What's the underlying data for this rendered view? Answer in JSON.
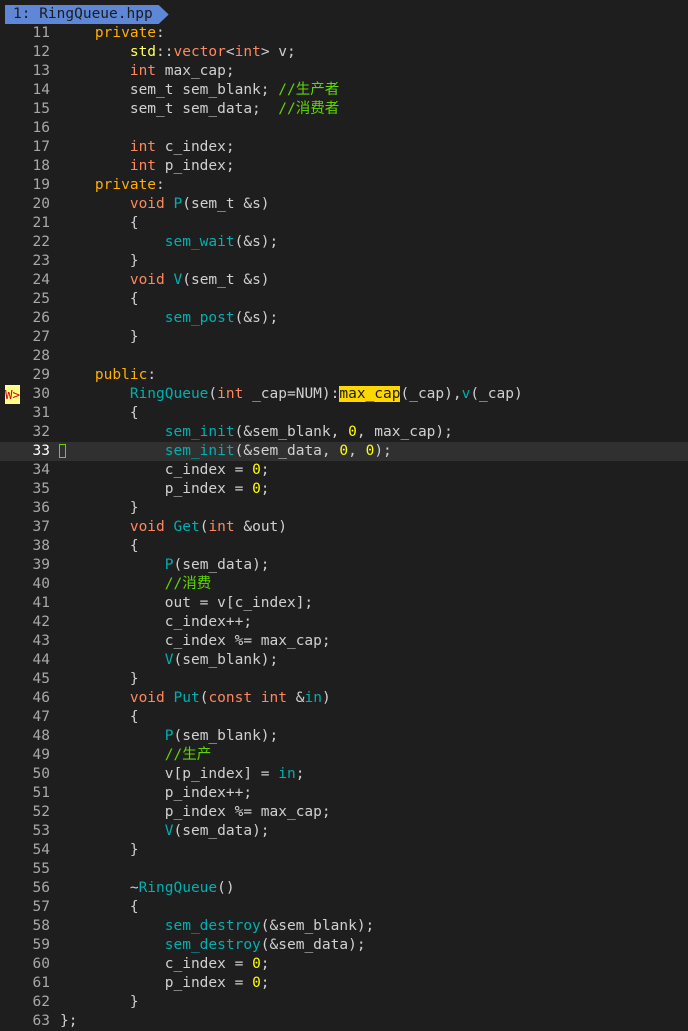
{
  "tab": {
    "label": "1: RingQueue.hpp"
  },
  "colors": {
    "background": "#1e1e1e",
    "tab": "#5f87d7",
    "keyword": "#ffaf00",
    "type": "#ff875f",
    "function": "#00afaf",
    "number": "#ffff00",
    "comment": "#5fd700",
    "sign": "#ffff87"
  },
  "editor": {
    "current_line": "33",
    "sign_label": "W>",
    "sign_line": "30",
    "lines": [
      {
        "n": "11",
        "t": [
          [
            "kw",
            "    private"
          ],
          [
            "",
            ":"
          ]
        ]
      },
      {
        "n": "12",
        "t": [
          [
            "ns",
            "        std"
          ],
          [
            "",
            "::"
          ],
          [
            "ty",
            "vector"
          ],
          [
            "",
            "<"
          ],
          [
            "ty",
            "int"
          ],
          [
            "",
            "> v;"
          ]
        ]
      },
      {
        "n": "13",
        "t": [
          [
            "ty",
            "        int"
          ],
          [
            "",
            " max_cap;"
          ]
        ]
      },
      {
        "n": "14",
        "t": [
          [
            "",
            "        sem_t sem_blank; "
          ],
          [
            "cm",
            "//生产者"
          ]
        ]
      },
      {
        "n": "15",
        "t": [
          [
            "",
            "        sem_t sem_data;  "
          ],
          [
            "cm",
            "//消费者"
          ]
        ]
      },
      {
        "n": "16",
        "t": []
      },
      {
        "n": "17",
        "t": [
          [
            "ty",
            "        int"
          ],
          [
            "",
            " c_index;"
          ]
        ]
      },
      {
        "n": "18",
        "t": [
          [
            "ty",
            "        int"
          ],
          [
            "",
            " p_index;"
          ]
        ]
      },
      {
        "n": "19",
        "t": [
          [
            "kw",
            "    private"
          ],
          [
            "",
            ":"
          ]
        ]
      },
      {
        "n": "20",
        "t": [
          [
            "ty",
            "        void"
          ],
          [
            "",
            " "
          ],
          [
            "fn",
            "P"
          ],
          [
            "",
            "(sem_t &s)"
          ]
        ]
      },
      {
        "n": "21",
        "t": [
          [
            "",
            "        {"
          ]
        ]
      },
      {
        "n": "22",
        "t": [
          [
            "fn",
            "            sem_wait"
          ],
          [
            "",
            "(&s);"
          ]
        ]
      },
      {
        "n": "23",
        "t": [
          [
            "",
            "        }"
          ]
        ]
      },
      {
        "n": "24",
        "t": [
          [
            "ty",
            "        void"
          ],
          [
            "",
            " "
          ],
          [
            "fn",
            "V"
          ],
          [
            "",
            "(sem_t &s)"
          ]
        ]
      },
      {
        "n": "25",
        "t": [
          [
            "",
            "        {"
          ]
        ]
      },
      {
        "n": "26",
        "t": [
          [
            "fn",
            "            sem_post"
          ],
          [
            "",
            "(&s);"
          ]
        ]
      },
      {
        "n": "27",
        "t": [
          [
            "",
            "        }"
          ]
        ]
      },
      {
        "n": "28",
        "t": []
      },
      {
        "n": "29",
        "t": [
          [
            "kw",
            "    public"
          ],
          [
            "",
            ":"
          ]
        ]
      },
      {
        "n": "30",
        "t": [
          [
            "fn",
            "        RingQueue"
          ],
          [
            "",
            "("
          ],
          [
            "ty",
            "int"
          ],
          [
            "",
            " _cap=NUM):"
          ],
          [
            "hl",
            "max_cap"
          ],
          [
            "",
            "(_cap),"
          ],
          [
            "fn",
            "v"
          ],
          [
            "",
            "(_cap)"
          ]
        ]
      },
      {
        "n": "31",
        "t": [
          [
            "",
            "        {"
          ]
        ]
      },
      {
        "n": "32",
        "t": [
          [
            "fn",
            "            sem_init"
          ],
          [
            "",
            "(&sem_blank, "
          ],
          [
            "num-lit",
            "0"
          ],
          [
            "",
            ", max_cap);"
          ]
        ]
      },
      {
        "n": "33",
        "t": [
          [
            "fn",
            "            sem_init"
          ],
          [
            "",
            "(&sem_data, "
          ],
          [
            "num-lit",
            "0"
          ],
          [
            "",
            ", "
          ],
          [
            "num-lit",
            "0"
          ],
          [
            "",
            ");"
          ]
        ]
      },
      {
        "n": "34",
        "t": [
          [
            "",
            "            c_index = "
          ],
          [
            "num-lit",
            "0"
          ],
          [
            "",
            ";"
          ]
        ]
      },
      {
        "n": "35",
        "t": [
          [
            "",
            "            p_index = "
          ],
          [
            "num-lit",
            "0"
          ],
          [
            "",
            ";"
          ]
        ]
      },
      {
        "n": "36",
        "t": [
          [
            "",
            "        }"
          ]
        ]
      },
      {
        "n": "37",
        "t": [
          [
            "ty",
            "        void"
          ],
          [
            "",
            " "
          ],
          [
            "fn",
            "Get"
          ],
          [
            "",
            "("
          ],
          [
            "ty",
            "int"
          ],
          [
            "",
            " &out)"
          ]
        ]
      },
      {
        "n": "38",
        "t": [
          [
            "",
            "        {"
          ]
        ]
      },
      {
        "n": "39",
        "t": [
          [
            "fn",
            "            P"
          ],
          [
            "",
            "(sem_data);"
          ]
        ]
      },
      {
        "n": "40",
        "t": [
          [
            "cm",
            "            //消费"
          ]
        ]
      },
      {
        "n": "41",
        "t": [
          [
            "",
            "            out = v[c_index];"
          ]
        ]
      },
      {
        "n": "42",
        "t": [
          [
            "",
            "            c_index++;"
          ]
        ]
      },
      {
        "n": "43",
        "t": [
          [
            "",
            "            c_index %= max_cap;"
          ]
        ]
      },
      {
        "n": "44",
        "t": [
          [
            "fn",
            "            V"
          ],
          [
            "",
            "(sem_blank);"
          ]
        ]
      },
      {
        "n": "45",
        "t": [
          [
            "",
            "        }"
          ]
        ]
      },
      {
        "n": "46",
        "t": [
          [
            "ty",
            "        void"
          ],
          [
            "",
            " "
          ],
          [
            "fn",
            "Put"
          ],
          [
            "",
            "("
          ],
          [
            "ty",
            "const"
          ],
          [
            "",
            " "
          ],
          [
            "ty",
            "int"
          ],
          [
            "",
            " &"
          ],
          [
            "fn",
            "in"
          ],
          [
            "",
            ")"
          ]
        ]
      },
      {
        "n": "47",
        "t": [
          [
            "",
            "        {"
          ]
        ]
      },
      {
        "n": "48",
        "t": [
          [
            "fn",
            "            P"
          ],
          [
            "",
            "(sem_blank);"
          ]
        ]
      },
      {
        "n": "49",
        "t": [
          [
            "cm",
            "            //生产"
          ]
        ]
      },
      {
        "n": "50",
        "t": [
          [
            "",
            "            v[p_index] = "
          ],
          [
            "fn",
            "in"
          ],
          [
            "",
            ";"
          ]
        ]
      },
      {
        "n": "51",
        "t": [
          [
            "",
            "            p_index++;"
          ]
        ]
      },
      {
        "n": "52",
        "t": [
          [
            "",
            "            p_index %= max_cap;"
          ]
        ]
      },
      {
        "n": "53",
        "t": [
          [
            "fn",
            "            V"
          ],
          [
            "",
            "(sem_data);"
          ]
        ]
      },
      {
        "n": "54",
        "t": [
          [
            "",
            "        }"
          ]
        ]
      },
      {
        "n": "55",
        "t": []
      },
      {
        "n": "56",
        "t": [
          [
            "",
            "        ~"
          ],
          [
            "fn",
            "RingQueue"
          ],
          [
            "",
            "()"
          ]
        ]
      },
      {
        "n": "57",
        "t": [
          [
            "",
            "        {"
          ]
        ]
      },
      {
        "n": "58",
        "t": [
          [
            "fn",
            "            sem_destroy"
          ],
          [
            "",
            "(&sem_blank);"
          ]
        ]
      },
      {
        "n": "59",
        "t": [
          [
            "fn",
            "            sem_destroy"
          ],
          [
            "",
            "(&sem_data);"
          ]
        ]
      },
      {
        "n": "60",
        "t": [
          [
            "",
            "            c_index = "
          ],
          [
            "num-lit",
            "0"
          ],
          [
            "",
            ";"
          ]
        ]
      },
      {
        "n": "61",
        "t": [
          [
            "",
            "            p_index = "
          ],
          [
            "num-lit",
            "0"
          ],
          [
            "",
            ";"
          ]
        ]
      },
      {
        "n": "62",
        "t": [
          [
            "",
            "        }"
          ]
        ]
      },
      {
        "n": "63",
        "t": [
          [
            "",
            "};"
          ]
        ]
      }
    ]
  }
}
